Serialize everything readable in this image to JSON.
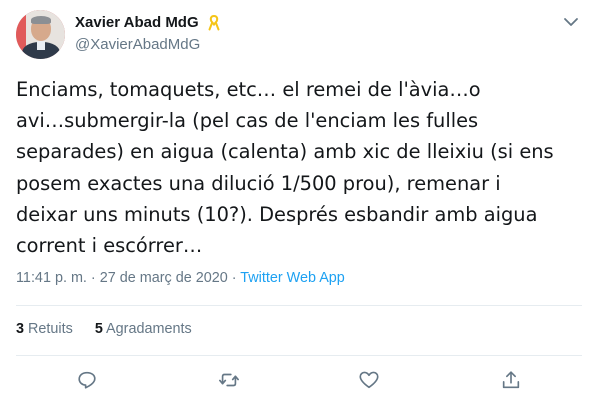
{
  "author": {
    "display_name": "Xavier Abad MdG",
    "handle": "@XavierAbadMdG",
    "ribbon_color": "#f5c518"
  },
  "tweet": {
    "text": "Enciams, tomaquets, etc… el remei de l'àvia…o\navi…submergir-la (pel cas de l'enciam les fulles\nseparades) en aigua (calenta) amb xic de lleixiu (si ens\nposem exactes una dilució 1/500 prou), remenar i\ndeixar uns minuts (10?). Després esbandir amb aigua\ncorrent i escórrer…",
    "time": "11:41 p. m.",
    "separator": " · ",
    "date": "27 de març de 2020",
    "app": "Twitter Web App"
  },
  "stats": {
    "retweets_count": "3",
    "retweets_label": "Retuits",
    "likes_count": "5",
    "likes_label": "Agradaments"
  },
  "icons": {
    "more": "chevron-down-icon",
    "reply": "reply-icon",
    "retweet": "retweet-icon",
    "like": "heart-icon",
    "share": "share-icon"
  },
  "colors": {
    "text": "#14171a",
    "secondary": "#657786",
    "link": "#1da1f2",
    "divider": "#e6ecf0"
  }
}
